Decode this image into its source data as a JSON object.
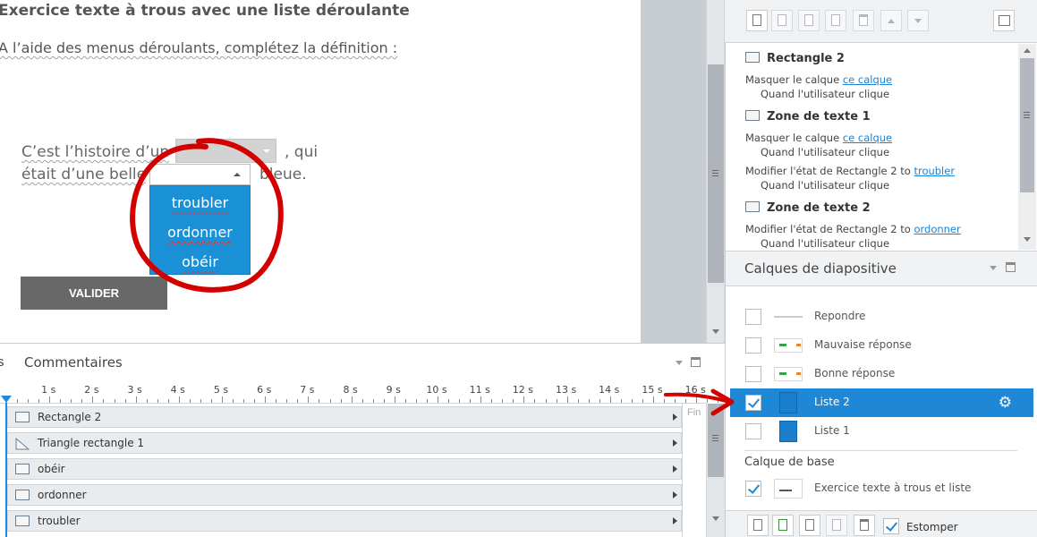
{
  "slide": {
    "title": "Exercice texte à trous avec une liste déroulante",
    "intro": "A l’aide des menus déroulants, complétez la définition :",
    "story_line1_start": "C’est l’histoire d’un",
    "story_line1_end": ", qui",
    "story_line2_start": "était d’une belle",
    "story_line2_end": "bleue.",
    "dropdown_options": [
      "troubler",
      "ordonner",
      "obéir"
    ],
    "valider_label": "VALIDER"
  },
  "timeline": {
    "prev_tab": "s",
    "tab_label": "Commentaires",
    "ticks": [
      "1 s",
      "2 s",
      "3 s",
      "4 s",
      "5 s",
      "6 s",
      "7 s",
      "8 s",
      "9 s",
      "10 s",
      "11 s",
      "12 s",
      "13 s",
      "14 s",
      "15 s",
      "16 s"
    ],
    "end_label": "Fin",
    "tracks": [
      {
        "label": "Rectangle 2",
        "icon": "rectangle-icon"
      },
      {
        "label": "Triangle rectangle 1",
        "icon": "triangle-icon"
      },
      {
        "label": "obéir",
        "icon": "text-box-icon"
      },
      {
        "label": "ordonner",
        "icon": "text-box-icon"
      },
      {
        "label": "troubler",
        "icon": "text-box-icon"
      }
    ]
  },
  "triggers": {
    "groups": [
      {
        "title": "Rectangle 2",
        "icon": "rectangle-icon",
        "actions": [
          {
            "text": "Masquer le calque ",
            "link": "ce calque",
            "when": "Quand l'utilisateur clique"
          }
        ]
      },
      {
        "title": "Zone de texte 1",
        "icon": "text-box-icon",
        "actions": [
          {
            "text": "Masquer le calque ",
            "link": "ce calque",
            "when": "Quand l'utilisateur clique"
          },
          {
            "text": "Modifier l'état de Rectangle 2 to ",
            "link": "troubler",
            "when": "Quand l'utilisateur clique"
          }
        ]
      },
      {
        "title": "Zone de texte 2",
        "icon": "text-box-icon",
        "actions": [
          {
            "text": "Modifier l'état de Rectangle 2 to ",
            "link": "ordonner",
            "when": "Quand l'utilisateur clique"
          }
        ]
      }
    ]
  },
  "layers": {
    "title": "Calques de diapositive",
    "items": [
      {
        "label": "Repondre",
        "checked": false,
        "selected": false
      },
      {
        "label": "Mauvaise réponse",
        "checked": false,
        "selected": false
      },
      {
        "label": "Bonne réponse",
        "checked": false,
        "selected": false
      },
      {
        "label": "Liste 2",
        "checked": true,
        "selected": true
      },
      {
        "label": "Liste 1",
        "checked": false,
        "selected": false
      }
    ],
    "base_title": "Calque de base",
    "base_label": "Exercice texte à trous et liste",
    "estomper_label": "Estomper"
  },
  "colors": {
    "accent": "#1e87d6",
    "annotation_red": "#d40000",
    "valider_bg": "#686868",
    "link": "#1d82d1"
  }
}
